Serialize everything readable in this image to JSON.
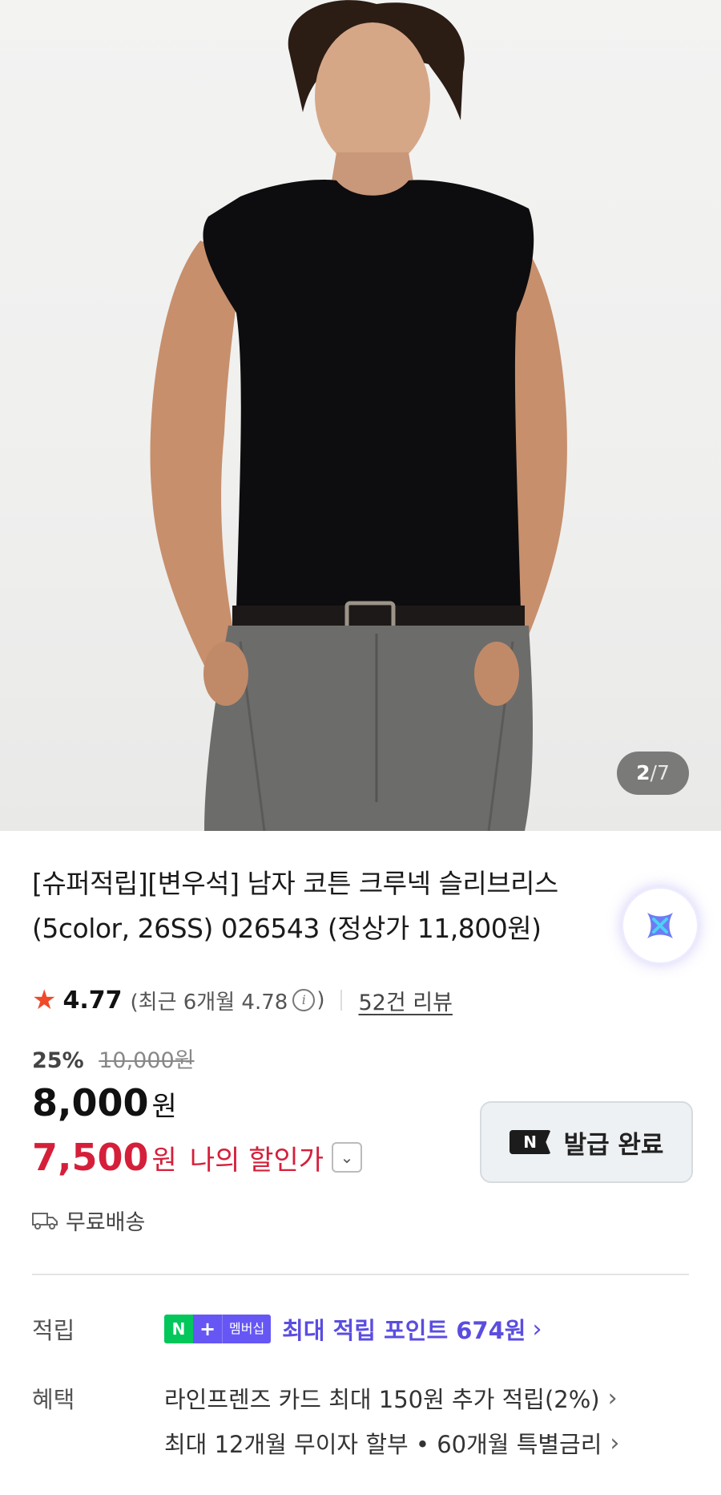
{
  "gallery": {
    "current": "2",
    "separator": "/",
    "total": "7"
  },
  "product": {
    "title_line1": "[슈퍼적립][변우석] 남자 코튼 크루넥 슬리브리스",
    "title_line2": "(5color, 26SS) 026543 (정상가 11,800원)"
  },
  "rating": {
    "score": "4.77",
    "recent_label": "(최근 6개월 4.78",
    "recent_close": ")",
    "reviews": "52건 리뷰"
  },
  "price": {
    "discount_pct": "25%",
    "original": "10,000원",
    "sale": "8,000",
    "unit": "원",
    "my_price": "7,500",
    "my_price_label": "나의 할인가"
  },
  "coupon": {
    "badge": "N",
    "label": "발급 완료"
  },
  "shipping": {
    "label": "무료배송"
  },
  "benefits": {
    "points_label": "적립",
    "membership_badge": [
      "N",
      "+",
      "멤버십"
    ],
    "points_text": "최대 적립 포인트 674원",
    "perks_label": "혜택",
    "perk1": "라인프렌즈 카드 최대 150원 추가 적립(2%)",
    "perk2": "최대 12개월 무이자 할부 • 60개월 특별금리"
  },
  "colors": {
    "accent_red": "#d51f3a",
    "accent_purple": "#5a4de0",
    "naver_green": "#03c75a",
    "star": "#f0492a"
  },
  "icons": [
    "star-icon",
    "info-icon",
    "chevron-down-icon",
    "truck-icon",
    "chevron-right-icon",
    "ai-assistant-icon"
  ]
}
